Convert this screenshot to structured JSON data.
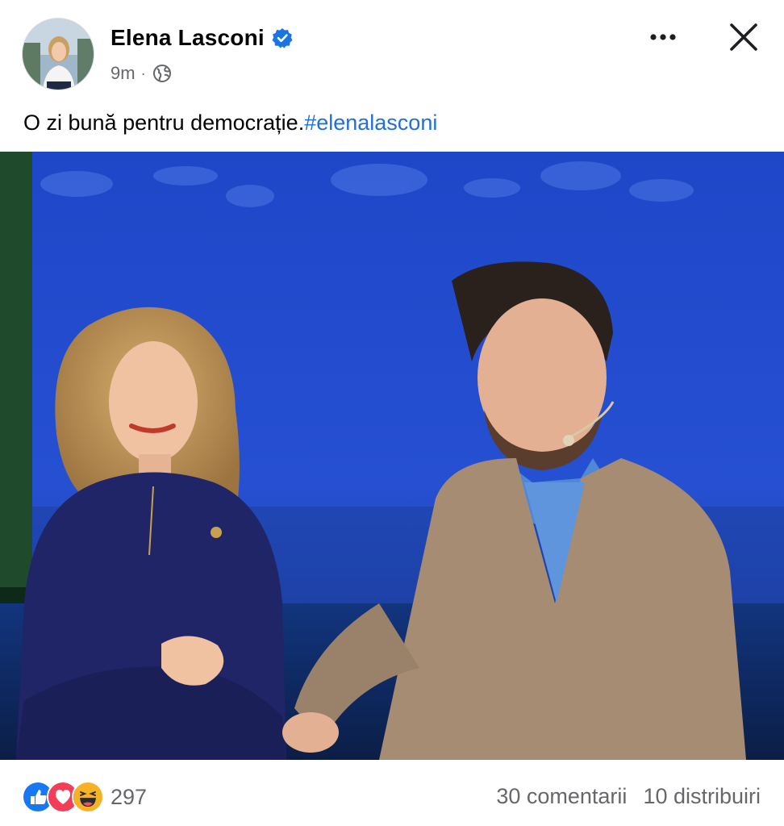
{
  "post": {
    "author": {
      "name": "Elena Lasconi",
      "verified": true,
      "avatar_icon": "profile-photo"
    },
    "time": "9m",
    "separator": "·",
    "audience_icon": "globe-icon",
    "caption": {
      "text": "O zi bună pentru democrație.",
      "hashtag": "#elenalasconi"
    },
    "image_icon": "photo-two-people-on-stage"
  },
  "actions": {
    "more_icon": "more-horizontal-icon",
    "close_icon": "close-icon"
  },
  "footer": {
    "reaction_icons": [
      "like-icon",
      "love-icon",
      "haha-icon"
    ],
    "reaction_count": "297",
    "comments": "30 comentarii",
    "shares": "10 distribuiri"
  },
  "colors": {
    "link": "#216fdb",
    "secondary_text": "#65676b",
    "verified_badge": "#1b74e4",
    "like": "#1877f2",
    "love": "#f33e58",
    "haha": "#f7b125"
  }
}
